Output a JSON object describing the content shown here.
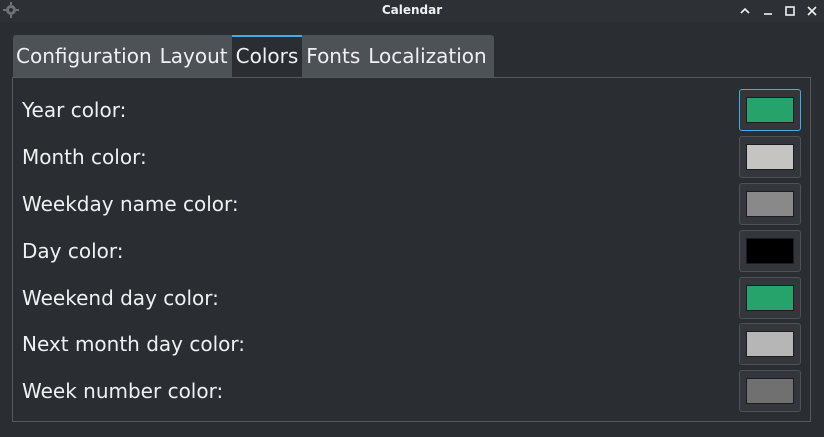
{
  "window": {
    "title": "Calendar",
    "icons": [
      "app-gear-icon",
      "keep-above-icon",
      "minimize-icon",
      "maximize-icon",
      "close-icon"
    ]
  },
  "tabs": [
    {
      "label": "Configuration",
      "active": false
    },
    {
      "label": "Layout",
      "active": false
    },
    {
      "label": "Colors",
      "active": true
    },
    {
      "label": "Fonts",
      "active": false
    },
    {
      "label": "Localization",
      "active": false
    }
  ],
  "theme": {
    "accent": "#3daee9",
    "background": "#2a2e32",
    "tab_inactive": "#4d5257"
  },
  "colors": [
    {
      "label": "Year color:",
      "value": "#25a36b",
      "focused": true
    },
    {
      "label": "Month color:",
      "value": "#c6c4c0",
      "focused": false
    },
    {
      "label": "Weekday name color:",
      "value": "#898989",
      "focused": false
    },
    {
      "label": "Day color:",
      "value": "#000000",
      "focused": false
    },
    {
      "label": "Weekend day color:",
      "value": "#25a36b",
      "focused": false
    },
    {
      "label": "Next month day color:",
      "value": "#b6b6b6",
      "focused": false
    },
    {
      "label": "Week number color:",
      "value": "#707070",
      "focused": false
    }
  ]
}
